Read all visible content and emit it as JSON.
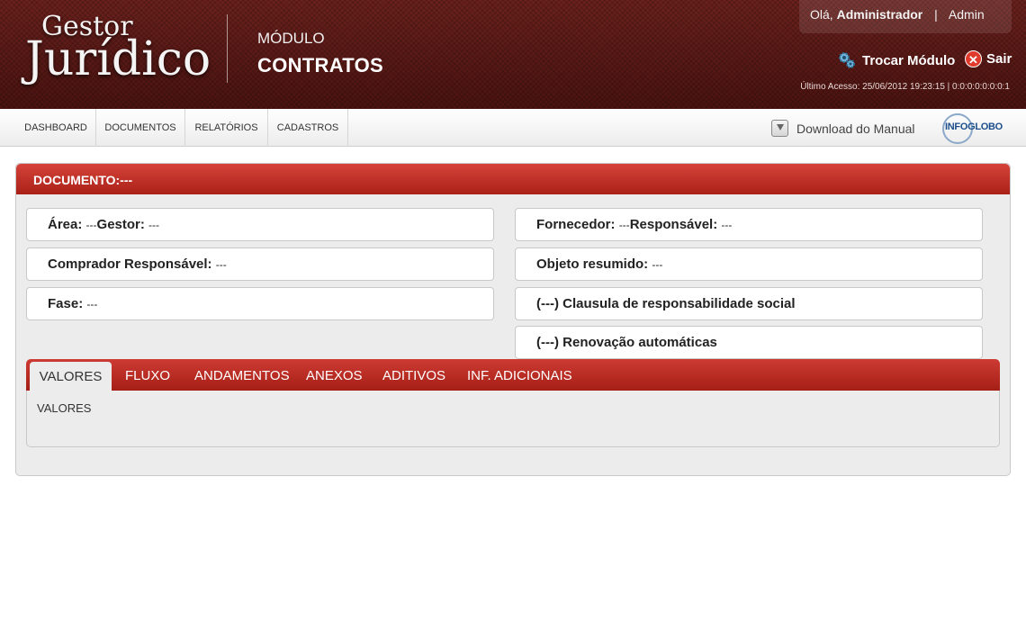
{
  "app": {
    "logo_top": "Gestor",
    "logo_main": "Jurídico",
    "module_label": "MÓDULO",
    "module_name": "CONTRATOS"
  },
  "user": {
    "greeting": "Olá,",
    "name": "Administrador",
    "separator": "|",
    "role": "Admin"
  },
  "actions": {
    "switch_module": "Trocar Módulo",
    "logout": "Sair",
    "last_access": "Último Acesso: 25/06/2012 19:23:15 | 0:0:0:0:0:0:0:1"
  },
  "nav": {
    "items": [
      "DASHBOARD",
      "DOCUMENTOS",
      "RELATÓRIOS",
      "CADASTROS"
    ],
    "download_manual": "Download do Manual",
    "brand": "INFOGLOBO"
  },
  "document": {
    "title": "DOCUMENTO:---",
    "fields": {
      "area_label": "Área:",
      "area_value": "---",
      "gestor_label": "Gestor:",
      "gestor_value": "---",
      "comprador_label": "Comprador Responsável:",
      "comprador_value": "---",
      "fase_label": "Fase:",
      "fase_value": "---",
      "fornecedor_label": "Fornecedor:",
      "fornecedor_value": "---",
      "responsavel_label": "Responsável:",
      "responsavel_value": "---",
      "objeto_label": "Objeto resumido:",
      "objeto_value": "---",
      "clausula": "(---) Clausula de responsabilidade social",
      "renovacao": "(---) Renovação automáticas"
    }
  },
  "tabs": {
    "items": [
      "VALORES",
      "FLUXO",
      "ANDAMENTOS",
      "ANEXOS",
      "ADITIVOS",
      "INF. ADICIONAIS"
    ],
    "active": "VALORES",
    "content": "VALORES"
  },
  "colors": {
    "header_bg": "#5a1a17",
    "accent_red": "#b8281e",
    "panel_bg": "#ececec"
  }
}
